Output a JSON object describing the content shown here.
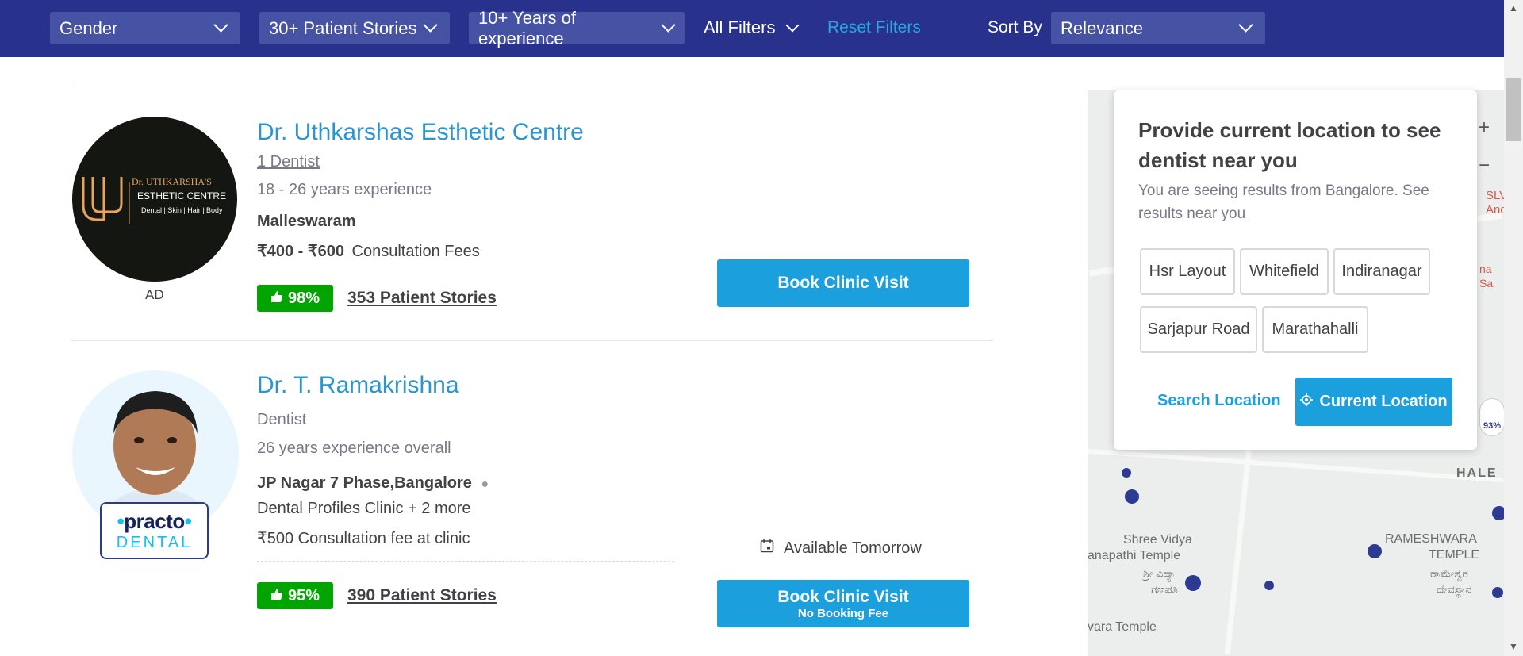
{
  "filters": {
    "gender": "Gender",
    "stories": "30+ Patient Stories",
    "experience": "10+ Years of experience",
    "all_filters": "All Filters",
    "reset": "Reset Filters",
    "sort_label": "Sort By",
    "sort_value": "Relevance"
  },
  "colors": {
    "filter_bar": "#28328c",
    "primary_blue": "#1ca0dd",
    "rating_green": "#01a400",
    "link_blue": "#2a95d1"
  },
  "listings": [
    {
      "logo": {
        "line1": "Dr. UTHKARSHA'S",
        "line2": "ESTHETIC CENTRE",
        "tags": "Dental | Skin | Hair | Body"
      },
      "ad_label": "AD",
      "name": "Dr. Uthkarshas Esthetic Centre",
      "dentist_count": "1 Dentist",
      "experience": "18 - 26 years experience",
      "location": "Malleswaram",
      "fee_range": "₹400 - ₹600",
      "fee_label": "Consultation Fees",
      "rating": "98%",
      "stories": "353 Patient Stories",
      "book_label": "Book Clinic Visit"
    },
    {
      "badge_brand": "practo",
      "badge_sub": "DENTAL",
      "name": "Dr. T. Ramakrishna",
      "specialty": "Dentist",
      "experience": "26 years experience overall",
      "location": "JP Nagar 7 Phase,Bangalore",
      "clinic": "Dental Profiles Clinic + 2 more",
      "fee": "₹500 Consultation fee at clinic",
      "availability": "Available Tomorrow",
      "rating": "95%",
      "stories": "390 Patient Stories",
      "book_label": "Book Clinic Visit",
      "book_sub": "No Booking Fee"
    }
  ],
  "location_popup": {
    "title": "Provide current location to see dentist near you",
    "note": "You are seeing results from Bangalore. See results near you",
    "chips": [
      "Hsr Layout",
      "Whitefield",
      "Indiranagar",
      "Sarjapur Road",
      "Marathahalli"
    ],
    "search_label": "Search Location",
    "current_label": "Current Location"
  },
  "map": {
    "zoom_in": "+",
    "zoom_out": "−",
    "labels": [
      "Shree Vidya",
      "anapathi Temple",
      "ಶ್ರೀ ವಿದ್ಯಾ",
      "ಗಣಪತಿ",
      "RAMESHWARA",
      "TEMPLE",
      "ರಾಮೇಶ್ವರ",
      "ದೇವಸ್ಥಾನ",
      "vara Temple",
      "HALE",
      "SLV",
      "And",
      "na Sa"
    ],
    "marker_rating": "93%"
  }
}
